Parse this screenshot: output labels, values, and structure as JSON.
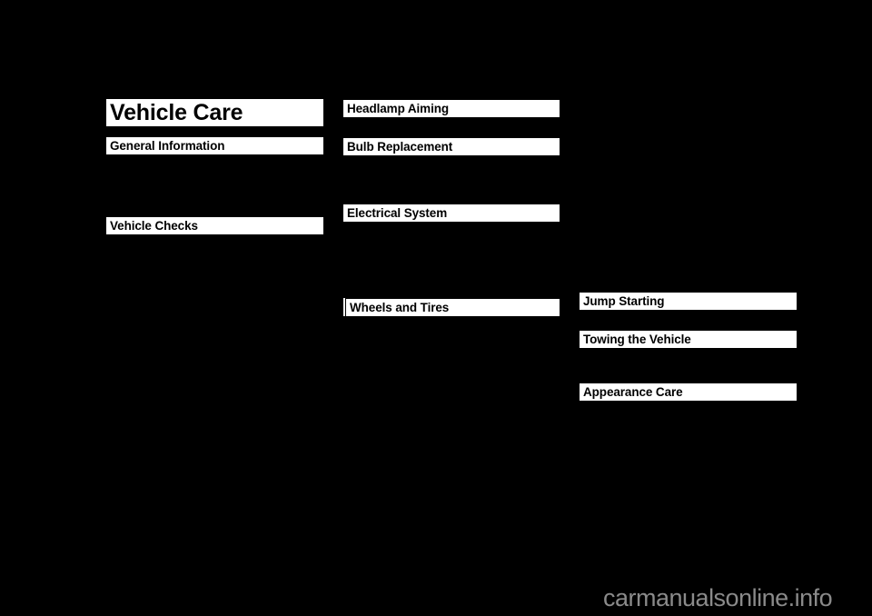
{
  "page": {
    "background_color": "#000000",
    "bar_color": "#ffffff",
    "bar_text_color": "#000000",
    "watermark_color": "#8a8a8a",
    "title": "Vehicle Care"
  },
  "columns": [
    {
      "name": "column-left",
      "sections": [
        {
          "label": "General Information"
        },
        {
          "label": "Vehicle Checks"
        }
      ]
    },
    {
      "name": "column-middle",
      "sections": [
        {
          "label": "Headlamp Aiming"
        },
        {
          "label": "Bulb Replacement"
        },
        {
          "label": "Electrical System"
        },
        {
          "label": "Wheels and Tires"
        }
      ]
    },
    {
      "name": "column-right",
      "sections": [
        {
          "label": "Jump Starting"
        },
        {
          "label": "Towing the Vehicle"
        },
        {
          "label": "Appearance Care"
        }
      ]
    }
  ],
  "watermark": {
    "text": "carmanualsonline.info"
  }
}
